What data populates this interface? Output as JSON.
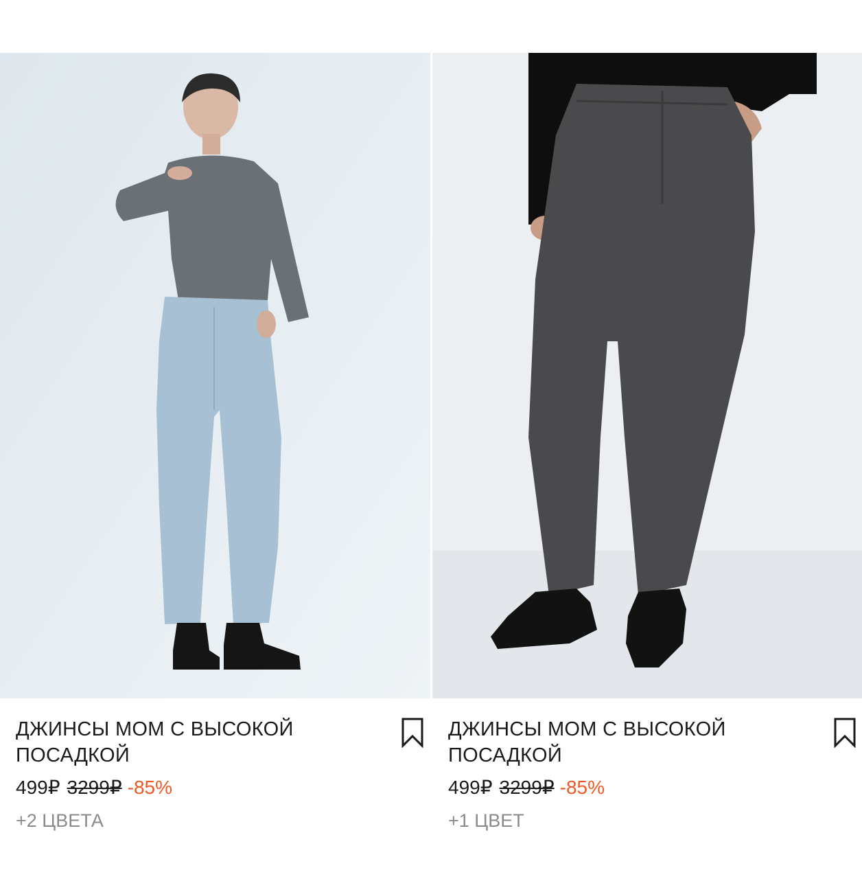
{
  "products": [
    {
      "title": "ДЖИНСЫ МОМ С ВЫСОКОЙ ПОСАДКОЙ",
      "price_current": "499₽",
      "price_old": "3299₽",
      "discount": "-85%",
      "colors": "+2 ЦВЕТА",
      "image_icon": "model-photo-light-jeans"
    },
    {
      "title": "ДЖИНСЫ МОМ С ВЫСОКОЙ ПОСАДКОЙ",
      "price_current": "499₽",
      "price_old": "3299₽",
      "discount": "-85%",
      "colors": "+1 ЦВЕТ",
      "image_icon": "model-photo-dark-jeans"
    }
  ],
  "colors": {
    "discount": "#ee5a24",
    "text": "#1a1a1a",
    "muted": "#8a8a8a"
  }
}
